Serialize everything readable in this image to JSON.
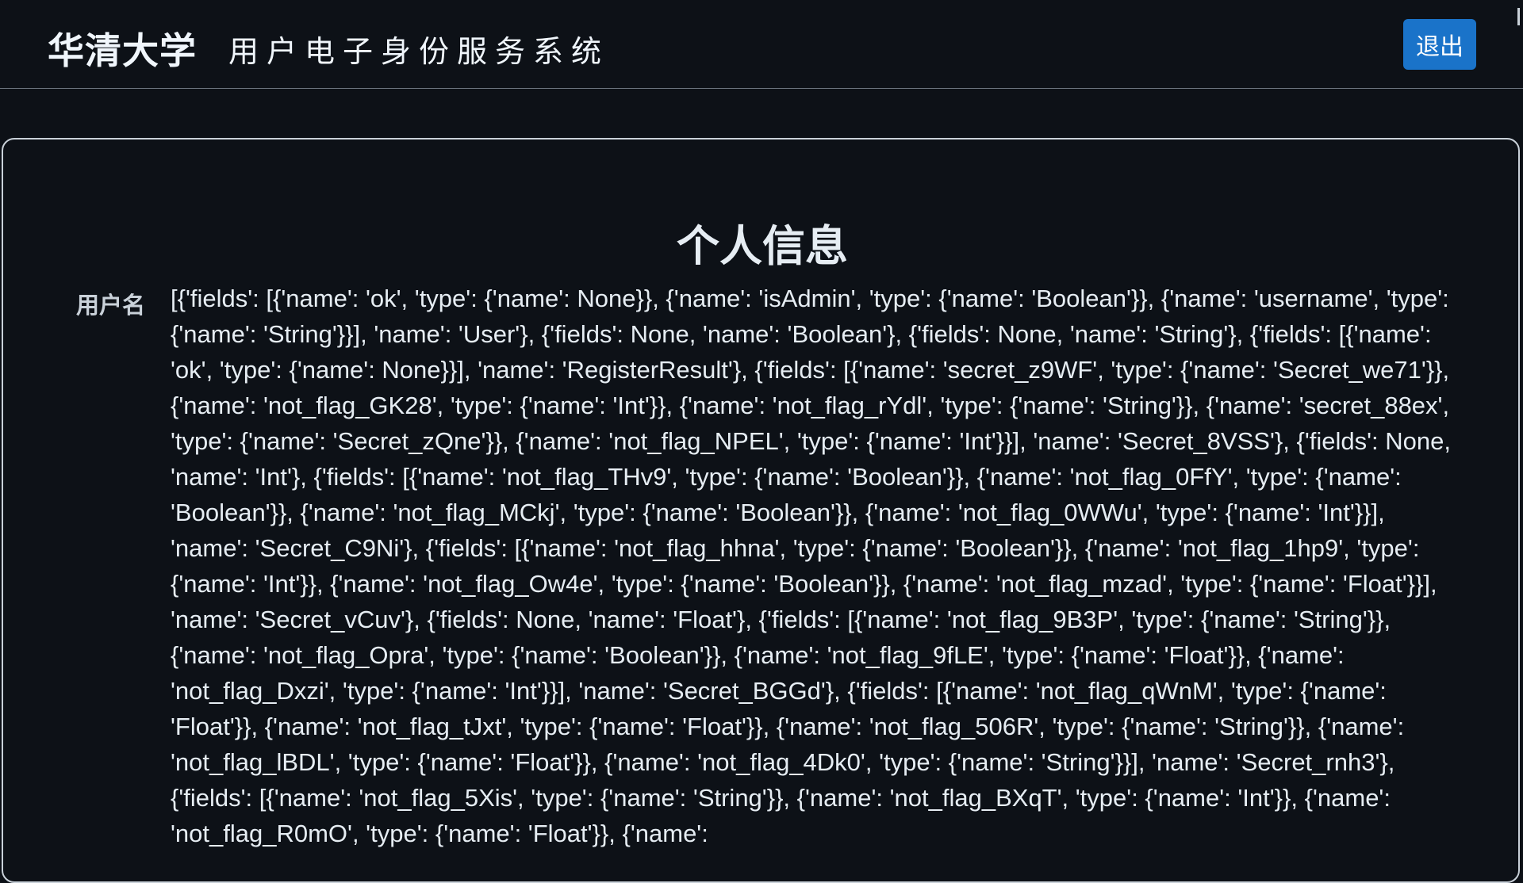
{
  "header": {
    "brand": "华清大学",
    "subtitle": "用户电子身份服务系统",
    "logout_label": "退出"
  },
  "profile": {
    "title": "个人信息",
    "username_label": "用户名",
    "username_value": "[{'fields': [{'name': 'ok', 'type': {'name': None}}, {'name': 'isAdmin', 'type': {'name': 'Boolean'}}, {'name': 'username', 'type': {'name': 'String'}}], 'name': 'User'}, {'fields': None, 'name': 'Boolean'}, {'fields': None, 'name': 'String'}, {'fields': [{'name': 'ok', 'type': {'name': None}}], 'name': 'RegisterResult'}, {'fields': [{'name': 'secret_z9WF', 'type': {'name': 'Secret_we71'}}, {'name': 'not_flag_GK28', 'type': {'name': 'Int'}}, {'name': 'not_flag_rYdl', 'type': {'name': 'String'}}, {'name': 'secret_88ex', 'type': {'name': 'Secret_zQne'}}, {'name': 'not_flag_NPEL', 'type': {'name': 'Int'}}], 'name': 'Secret_8VSS'}, {'fields': None, 'name': 'Int'}, {'fields': [{'name': 'not_flag_THv9', 'type': {'name': 'Boolean'}}, {'name': 'not_flag_0FfY', 'type': {'name': 'Boolean'}}, {'name': 'not_flag_MCkj', 'type': {'name': 'Boolean'}}, {'name': 'not_flag_0WWu', 'type': {'name': 'Int'}}], 'name': 'Secret_C9Ni'}, {'fields': [{'name': 'not_flag_hhna', 'type': {'name': 'Boolean'}}, {'name': 'not_flag_1hp9', 'type': {'name': 'Int'}}, {'name': 'not_flag_Ow4e', 'type': {'name': 'Boolean'}}, {'name': 'not_flag_mzad', 'type': {'name': 'Float'}}], 'name': 'Secret_vCuv'}, {'fields': None, 'name': 'Float'}, {'fields': [{'name': 'not_flag_9B3P', 'type': {'name': 'String'}}, {'name': 'not_flag_Opra', 'type': {'name': 'Boolean'}}, {'name': 'not_flag_9fLE', 'type': {'name': 'Float'}}, {'name': 'not_flag_Dxzi', 'type': {'name': 'Int'}}], 'name': 'Secret_BGGd'}, {'fields': [{'name': 'not_flag_qWnM', 'type': {'name': 'Float'}}, {'name': 'not_flag_tJxt', 'type': {'name': 'Float'}}, {'name': 'not_flag_506R', 'type': {'name': 'String'}}, {'name': 'not_flag_lBDL', 'type': {'name': 'Float'}}, {'name': 'not_flag_4Dk0', 'type': {'name': 'String'}}], 'name': 'Secret_rnh3'}, {'fields': [{'name': 'not_flag_5Xis', 'type': {'name': 'String'}}, {'name': 'not_flag_BXqT', 'type': {'name': 'Int'}}, {'name': 'not_flag_R0mO', 'type': {'name': 'Float'}}, {'name':"
  },
  "colors": {
    "background": "#0d1117",
    "button": "#1a73c9",
    "border": "#c9d1d9"
  }
}
